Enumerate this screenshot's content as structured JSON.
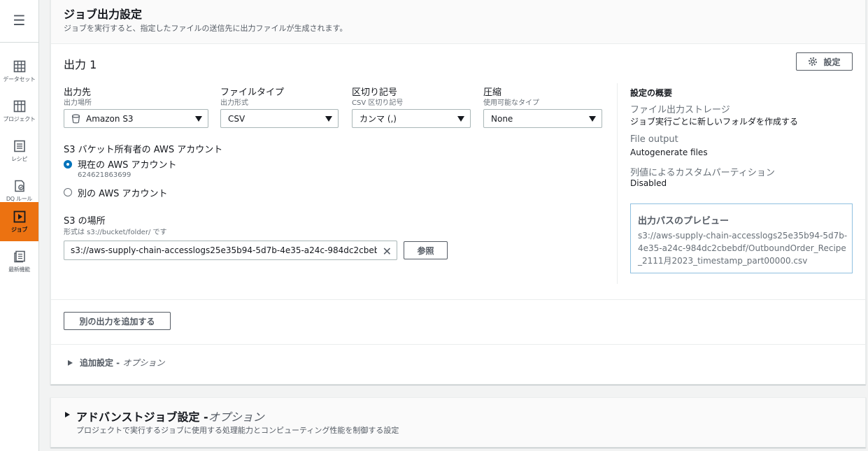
{
  "sidebar": {
    "menu_icon": "hamburger-icon",
    "items": [
      {
        "label": "データセット",
        "icon": "table-icon",
        "active": false
      },
      {
        "label": "プロジェクト",
        "icon": "grid-icon",
        "active": false
      },
      {
        "label": "レシピ",
        "icon": "list-icon",
        "active": false
      },
      {
        "label": "DQ ルール",
        "icon": "rule-check-icon",
        "active": false
      },
      {
        "label": "ジョブ",
        "icon": "play-icon",
        "active": true
      },
      {
        "label": "最新機能",
        "icon": "news-icon",
        "active": false
      }
    ]
  },
  "job_output": {
    "title": "ジョブ出力設定",
    "description": "ジョブを実行すると、指定したファイルの送信先に出力ファイルが生成されます。",
    "output_title": "出力 1",
    "settings_button": "設定",
    "fields": {
      "destination": {
        "label": "出力先",
        "sub": "出力場所",
        "value": "Amazon S3",
        "icon": "bucket-icon"
      },
      "file_type": {
        "label": "ファイルタイプ",
        "sub": "出力形式",
        "value": "CSV"
      },
      "delimiter": {
        "label": "区切り記号",
        "sub": "CSV 区切り記号",
        "value": "カンマ (,)"
      },
      "compression": {
        "label": "圧縮",
        "sub": "使用可能なタイプ",
        "value": "None"
      }
    },
    "bucket_owner": {
      "label": "S3 バケット所有者の AWS アカウント",
      "current": {
        "label": "現在の AWS アカウント",
        "account_id": "624621863699",
        "selected": true
      },
      "other": {
        "label": "別の AWS アカウント",
        "selected": false
      }
    },
    "s3_location": {
      "label": "S3 の場所",
      "sub": "形式は s3://bucket/folder/ です",
      "value": "s3://aws-supply-chain-accesslogs25e35b94-5d7b-4e35-a24c-984dc2cbebdf/",
      "browse_button": "参照"
    },
    "summary": {
      "title": "設定の概要",
      "items": [
        {
          "key": "ファイル出力ストレージ",
          "value": "ジョブ実行ごとに新しいフォルダを作成する"
        },
        {
          "key": "File output",
          "value": "Autogenerate files"
        },
        {
          "key": "列値によるカスタムパーティション",
          "value": "Disabled"
        }
      ],
      "preview_title": "出力パスのプレビュー",
      "preview_path": "s3://aws-supply-chain-accesslogs25e35b94-5d7b-4e35-a24c-984dc2cbebdf/OutboundOrder_Recipe_2111月2023_timestamp_part00000.csv"
    },
    "add_output_button": "別の出力を追加する",
    "additional_settings": {
      "label": "追加設定 - ",
      "option": "オプション"
    }
  },
  "advanced": {
    "title": "アドバンストジョブ設定 -",
    "option": "オプション",
    "description": "プロジェクトで実行するジョブに使用する処理能力とコンピューティング性能を制御する設定"
  },
  "colors": {
    "accent": "#ec7211",
    "link_blue": "#0073bb"
  }
}
